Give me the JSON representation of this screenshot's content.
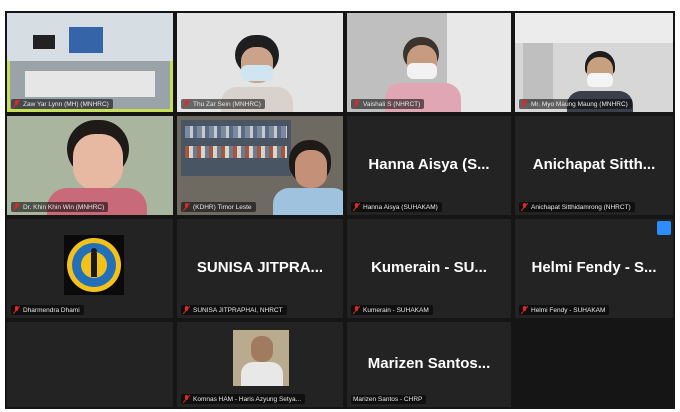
{
  "meeting": {
    "tiles": [
      {
        "name": "",
        "label": "Zaw Yar Lynn (MH) (MNHRC)",
        "kind": "video",
        "active": true
      },
      {
        "name": "",
        "label": "Thu Zar Sein (MNHRC)",
        "kind": "video"
      },
      {
        "name": "",
        "label": "Vaishali S (NHRCT)",
        "kind": "video"
      },
      {
        "name": "",
        "label": "Mr. Myo Maung Maung (MNHRC)",
        "kind": "video"
      },
      {
        "name": "",
        "label": "Dr. Khin Khin Win (MNHRC)",
        "kind": "video"
      },
      {
        "name": "",
        "label": "(KDHR) Timor Leste",
        "kind": "video"
      },
      {
        "name": "Hanna Aisya (S...",
        "label": "Hanna Aisya (SUHAKAM)",
        "kind": "name"
      },
      {
        "name": "Anichapat Sitth...",
        "label": "Anichapat Sitthidamrong (NHRCT)",
        "kind": "name"
      },
      {
        "name": "",
        "label": "Dharmendra Dhami",
        "kind": "logo"
      },
      {
        "name": "SUNISA JITPRA...",
        "label": "SUNISA JITPRAPHAI, NHRCT",
        "kind": "name"
      },
      {
        "name": "Kumerain - SU...",
        "label": "Kumerain - SUHAKAM",
        "kind": "name"
      },
      {
        "name": "Helmi Fendy - S...",
        "label": "Helmi Fendy - SUHAKAM",
        "kind": "name",
        "badge": true
      },
      {
        "name": "",
        "label": "",
        "kind": "empty"
      },
      {
        "name": "",
        "label": "Komnas HAM - Haris Azyung Setya...",
        "kind": "photo"
      },
      {
        "name": "Marizen Santos...",
        "label": "Marizen Santos - CHRP",
        "kind": "name"
      }
    ]
  },
  "colors": {
    "active_border": "#c7df52",
    "mic_muted": "#e02828",
    "badge": "#2d8cff"
  },
  "icons": {
    "mic": "mic-muted-icon"
  }
}
